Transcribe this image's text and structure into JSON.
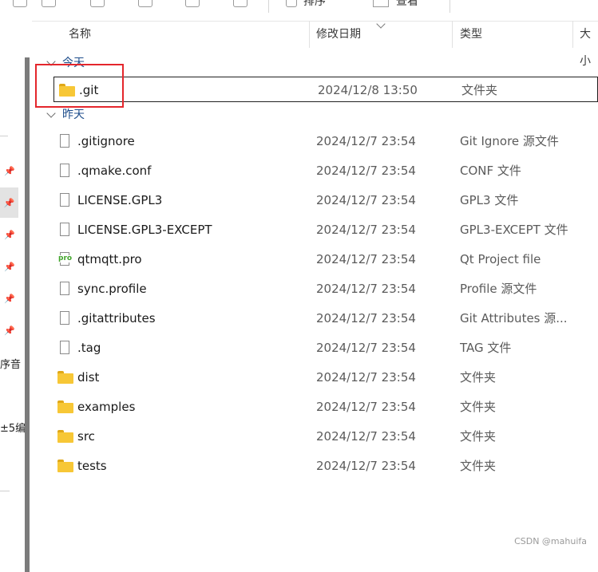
{
  "toolbar": {
    "sort_label": "排序",
    "view_label": "查看"
  },
  "nav": {
    "fragments": [
      "序音",
      "±5编"
    ]
  },
  "columns": {
    "name": "名称",
    "date": "修改日期",
    "type": "类型",
    "size": "大小"
  },
  "groups": {
    "today": "今天",
    "yesterday": "昨天"
  },
  "today_files": [
    {
      "name": ".git",
      "date": "2024/12/8 13:50",
      "type": "文件夹",
      "icon": "folder-icon"
    }
  ],
  "yesterday_files": [
    {
      "name": ".gitignore",
      "date": "2024/12/7 23:54",
      "type": "Git Ignore 源文件",
      "icon": "file-icon"
    },
    {
      "name": ".qmake.conf",
      "date": "2024/12/7 23:54",
      "type": "CONF 文件",
      "icon": "file-icon"
    },
    {
      "name": "LICENSE.GPL3",
      "date": "2024/12/7 23:54",
      "type": "GPL3 文件",
      "icon": "file-icon"
    },
    {
      "name": "LICENSE.GPL3-EXCEPT",
      "date": "2024/12/7 23:54",
      "type": "GPL3-EXCEPT 文件",
      "icon": "file-icon"
    },
    {
      "name": "qtmqtt.pro",
      "date": "2024/12/7 23:54",
      "type": "Qt Project file",
      "icon": "pro-file-icon"
    },
    {
      "name": "sync.profile",
      "date": "2024/12/7 23:54",
      "type": "Profile 源文件",
      "icon": "file-icon"
    },
    {
      "name": ".gitattributes",
      "date": "2024/12/7 23:54",
      "type": "Git Attributes 源...",
      "icon": "file-icon"
    },
    {
      "name": ".tag",
      "date": "2024/12/7 23:54",
      "type": "TAG 文件",
      "icon": "file-icon"
    },
    {
      "name": "dist",
      "date": "2024/12/7 23:54",
      "type": "文件夹",
      "icon": "folder-icon"
    },
    {
      "name": "examples",
      "date": "2024/12/7 23:54",
      "type": "文件夹",
      "icon": "folder-icon"
    },
    {
      "name": "src",
      "date": "2024/12/7 23:54",
      "type": "文件夹",
      "icon": "folder-icon"
    },
    {
      "name": "tests",
      "date": "2024/12/7 23:54",
      "type": "文件夹",
      "icon": "folder-icon"
    }
  ],
  "pro_badge": "pro",
  "watermark": "CSDN @mahuifa",
  "colors": {
    "highlight": "#e4262c",
    "folder": "#f7c736",
    "group_text": "#1f4e8c"
  }
}
